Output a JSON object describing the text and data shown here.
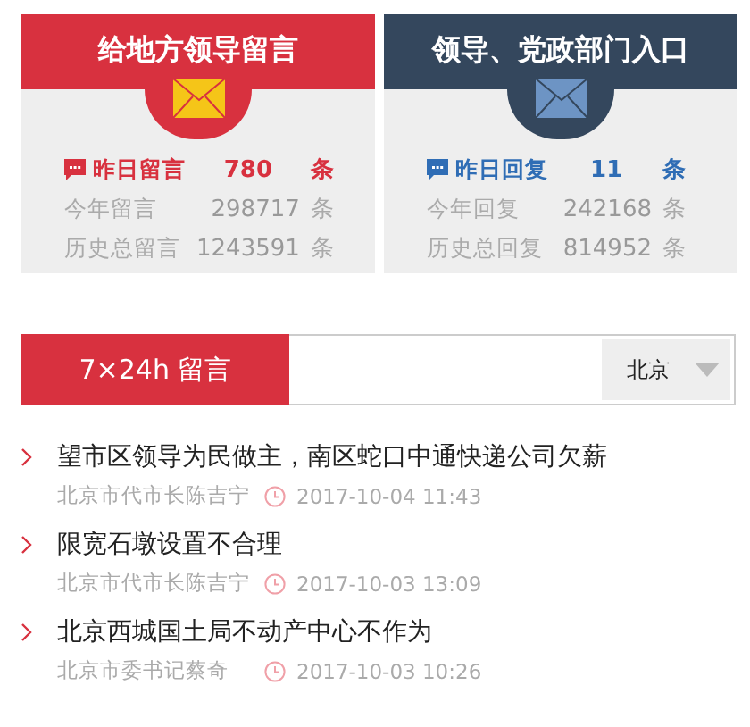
{
  "cards": [
    {
      "kind": "red",
      "title": "给地方领导留言",
      "stats": [
        {
          "kind": "highlight",
          "label": "昨日留言",
          "value": "780",
          "unit": "条"
        },
        {
          "kind": "plain",
          "label": "今年留言",
          "value": "298717",
          "unit": "条"
        },
        {
          "kind": "plain",
          "label": "历史总留言",
          "value": "1243591",
          "unit": "条"
        }
      ]
    },
    {
      "kind": "dark",
      "title": "领导、党政部门入口",
      "stats": [
        {
          "kind": "highlight",
          "label": "昨日回复",
          "value": "11",
          "unit": "条"
        },
        {
          "kind": "plain",
          "label": "今年回复",
          "value": "242168",
          "unit": "条"
        },
        {
          "kind": "plain",
          "label": "历史总回复",
          "value": "814952",
          "unit": "条"
        }
      ]
    }
  ],
  "board": {
    "tab": "7×24h 留言",
    "region": "北京"
  },
  "messages": [
    {
      "title": "望市区领导为民做主，南区蛇口中通快递公司欠薪",
      "recipient": "北京市代市长陈吉宁",
      "time": "2017-10-04 11:43"
    },
    {
      "title": "限宽石墩设置不合理",
      "recipient": "北京市代市长陈吉宁",
      "time": "2017-10-03 13:09"
    },
    {
      "title": "北京西城国土局不动产中心不作为",
      "recipient": "北京市委书记蔡奇",
      "time": "2017-10-03 10:26"
    }
  ]
}
